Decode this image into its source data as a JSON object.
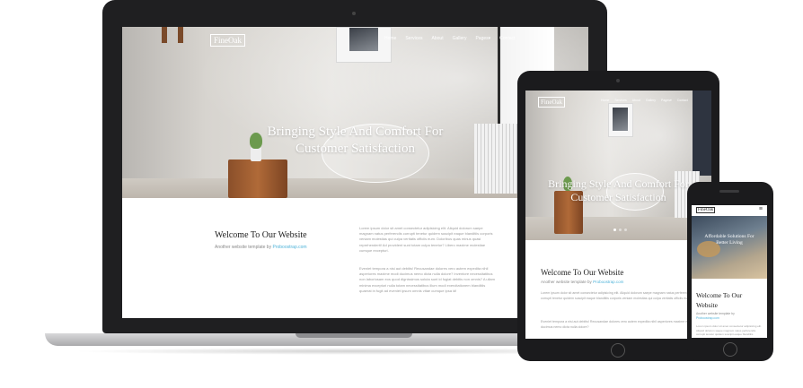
{
  "site": {
    "logo": "FineOak",
    "nav": [
      "Home",
      "Services",
      "About",
      "Gallery",
      "Pages",
      "Contact"
    ],
    "nav_dropdown_mark": "▾",
    "hero_line1": "Bringing Style And Comfort For",
    "hero_line2": "Customer Satisfaction",
    "welcome_title": "Welcome To Our Website",
    "welcome_sub_prefix": "Another website template by",
    "welcome_sub_link": "Proboostrap.com",
    "para1": "Lorem ipsum dolor sit amet consectetur adipisicing elit. Aliquid dolorum saepe magnam natus perferendis corrupti tenetur quidem suscipit eaque blanditiis corporis veniam molestias qui culpa veritatis officiis eum. Doloribus quas minus quasi reprehenderit! Ad provident sunt totam culpa tenetur? Libero maxime molestiae cumque excepturi.",
    "para2": "Eveniet tempora a nisi aut debitis! Recusandae dolores vero autem expedita nihil asperiores maxime modi ducimus nemo dicta nulla dolore? Inventore necessitatibus non laboriosam eos quod dignissimos soluta sunt id fugiat debitis non omnis? A ullam minima excepturi nulla totam necessitatibus illum modi exercitationem blanditiis quaerat in fugit ad eveniet ipsum omnis vitae cumque ipsa id!",
    "para1_short": "Lorem ipsum dolor sit amet consectetur adipisicing elit. Aliquid dolorum saepe magnam natus perferendis corrupti tenetur quidem suscipit eaque blanditiis corporis veniam molestias qui culpa veritatis officiis eum.",
    "para2_short": "Eveniet tempora a nisi aut debitis! Recusandae dolores vero autem expedita nihil asperiores maxime modi ducimus nemo dicta nulla dolore?",
    "phone_hero_line1": "Affordable Solutions For",
    "phone_hero_line2": "Better Living",
    "phone_welcome_line1": "Welcome To Our",
    "phone_welcome_line2": "Website",
    "phone_menu_icon": "≡"
  },
  "colors": {
    "link": "#4fb3d9",
    "device_body": "#1b1b1d",
    "laptop_base": "#c8c8ca",
    "stool_wood": "#a0602f"
  }
}
